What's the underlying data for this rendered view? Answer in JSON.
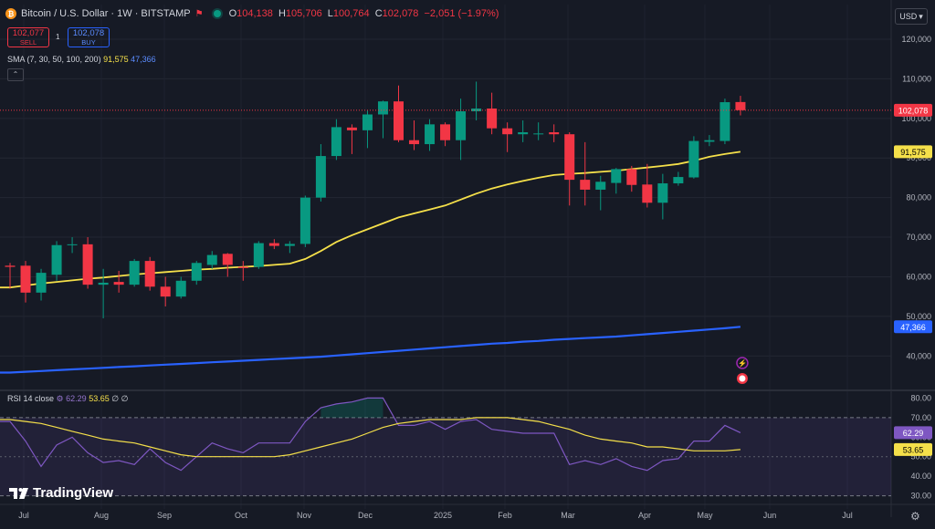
{
  "header": {
    "symbol_title": "Bitcoin / U.S. Dollar · 1W · BITSTAMP",
    "open_label": "O",
    "open": "104,138",
    "high_label": "H",
    "high": "105,706",
    "low_label": "L",
    "low": "100,764",
    "close_label": "C",
    "close": "102,078",
    "change": "−2,051 (−1.97%)"
  },
  "trade": {
    "sell_price": "102,077",
    "sell_label": "SELL",
    "buy_price": "102,078",
    "buy_label": "BUY",
    "spread": "1"
  },
  "indicators": {
    "sma_label": "SMA (7, 30, 50, 100, 200)",
    "sma_short_value": "91,575",
    "sma_long_value": "47,366",
    "rsi_label": "RSI 14 close",
    "rsi_value": "62.29",
    "rsi_ma_value": "53.65",
    "rsi_extra1": "∅",
    "rsi_extra2": "∅"
  },
  "currency": "USD",
  "branding": "TradingView",
  "colors": {
    "background": "#161a25",
    "up": "#089981",
    "down": "#f23645",
    "sma_short": "#f5e04a",
    "sma_long": "#2962ff",
    "rsi": "#7e57c2"
  },
  "chart_data": [
    {
      "type": "candlestick",
      "interval": "1W",
      "x_tick_labels": [
        "Jul",
        "Aug",
        "Sep",
        "Oct",
        "Nov",
        "Dec",
        "2025",
        "Feb",
        "Mar",
        "Apr",
        "May",
        "Jun",
        "Jul"
      ],
      "y_tick_labels": [
        "120,000",
        "110,000",
        "100,000",
        "90,000",
        "80,000",
        "70,000",
        "60,000",
        "50,000",
        "40,000"
      ],
      "ylim": [
        32000,
        123000
      ],
      "last_price_label": "102,078",
      "candles": [
        {
          "o": 62800,
          "h": 63500,
          "l": 57000,
          "c": 62500
        },
        {
          "o": 62800,
          "h": 64000,
          "l": 53500,
          "c": 56000
        },
        {
          "o": 56000,
          "h": 62000,
          "l": 54000,
          "c": 61000
        },
        {
          "o": 60500,
          "h": 69000,
          "l": 59000,
          "c": 68000
        },
        {
          "o": 68000,
          "h": 70000,
          "l": 66000,
          "c": 68200
        },
        {
          "o": 68200,
          "h": 70000,
          "l": 57000,
          "c": 58000
        },
        {
          "o": 58000,
          "h": 62000,
          "l": 49500,
          "c": 58500
        },
        {
          "o": 58700,
          "h": 61500,
          "l": 56000,
          "c": 58000
        },
        {
          "o": 58000,
          "h": 64500,
          "l": 57500,
          "c": 64000
        },
        {
          "o": 64000,
          "h": 65000,
          "l": 56500,
          "c": 57500
        },
        {
          "o": 57500,
          "h": 60000,
          "l": 52500,
          "c": 55000
        },
        {
          "o": 55000,
          "h": 60000,
          "l": 54500,
          "c": 59000
        },
        {
          "o": 59000,
          "h": 64000,
          "l": 58000,
          "c": 63500
        },
        {
          "o": 63000,
          "h": 66500,
          "l": 62000,
          "c": 65500
        },
        {
          "o": 65800,
          "h": 66000,
          "l": 60000,
          "c": 63000
        },
        {
          "o": 62500,
          "h": 64000,
          "l": 59000,
          "c": 62200
        },
        {
          "o": 62500,
          "h": 69000,
          "l": 62000,
          "c": 68500
        },
        {
          "o": 68500,
          "h": 69500,
          "l": 67000,
          "c": 67800
        },
        {
          "o": 67800,
          "h": 69000,
          "l": 66000,
          "c": 68300
        },
        {
          "o": 68300,
          "h": 80500,
          "l": 67500,
          "c": 80000
        },
        {
          "o": 80000,
          "h": 93500,
          "l": 79000,
          "c": 90500
        },
        {
          "o": 90500,
          "h": 99800,
          "l": 89500,
          "c": 97800
        },
        {
          "o": 97700,
          "h": 98500,
          "l": 91000,
          "c": 97000
        },
        {
          "o": 97000,
          "h": 102000,
          "l": 92500,
          "c": 101000
        },
        {
          "o": 101000,
          "h": 104500,
          "l": 95000,
          "c": 104300
        },
        {
          "o": 104300,
          "h": 108300,
          "l": 94000,
          "c": 94500
        },
        {
          "o": 94500,
          "h": 99500,
          "l": 92000,
          "c": 93500
        },
        {
          "o": 93500,
          "h": 99800,
          "l": 91800,
          "c": 98500
        },
        {
          "o": 98500,
          "h": 99000,
          "l": 93000,
          "c": 94500
        },
        {
          "o": 94500,
          "h": 105000,
          "l": 89500,
          "c": 101800
        },
        {
          "o": 101800,
          "h": 109300,
          "l": 99500,
          "c": 102500
        },
        {
          "o": 102500,
          "h": 106500,
          "l": 96000,
          "c": 97500
        },
        {
          "o": 97500,
          "h": 99000,
          "l": 91500,
          "c": 96000
        },
        {
          "o": 96000,
          "h": 99500,
          "l": 94000,
          "c": 96500
        },
        {
          "o": 96200,
          "h": 99000,
          "l": 94500,
          "c": 96200
        },
        {
          "o": 96500,
          "h": 98500,
          "l": 94000,
          "c": 96000
        },
        {
          "o": 96000,
          "h": 96500,
          "l": 78000,
          "c": 84500
        },
        {
          "o": 84500,
          "h": 94000,
          "l": 78000,
          "c": 82000
        },
        {
          "o": 82000,
          "h": 85500,
          "l": 76800,
          "c": 84000
        },
        {
          "o": 83700,
          "h": 87500,
          "l": 81000,
          "c": 87200
        },
        {
          "o": 87200,
          "h": 88000,
          "l": 81500,
          "c": 83200
        },
        {
          "o": 83300,
          "h": 88500,
          "l": 77500,
          "c": 78700
        },
        {
          "o": 78700,
          "h": 86000,
          "l": 74500,
          "c": 83600
        },
        {
          "o": 83600,
          "h": 86500,
          "l": 83000,
          "c": 85200
        },
        {
          "o": 85100,
          "h": 95500,
          "l": 84800,
          "c": 94300
        },
        {
          "o": 94100,
          "h": 95800,
          "l": 93000,
          "c": 94500
        },
        {
          "o": 94300,
          "h": 105000,
          "l": 93500,
          "c": 104100
        },
        {
          "o": 104138,
          "h": 105706,
          "l": 100764,
          "c": 102078
        }
      ],
      "sma_series": [
        {
          "name": "SMA (short)",
          "value_label": "91,575",
          "values": [
            57300,
            57800,
            58300,
            58700,
            59100,
            59500,
            59800,
            60200,
            60600,
            60900,
            61200,
            61500,
            61800,
            62000,
            62300,
            62500,
            62700,
            63000,
            63300,
            64500,
            66500,
            68800,
            70500,
            72000,
            73500,
            75000,
            76000,
            77000,
            78000,
            79500,
            81000,
            82300,
            83300,
            84200,
            85000,
            85700,
            86000,
            86200,
            86500,
            86800,
            87200,
            87600,
            88000,
            88500,
            89300,
            90300,
            91000,
            91575
          ]
        },
        {
          "name": "SMA (long)",
          "value_label": "47,366",
          "values": [
            35800,
            36000,
            36200,
            36400,
            36600,
            36800,
            37000,
            37200,
            37400,
            37600,
            37800,
            38000,
            38200,
            38400,
            38600,
            38800,
            39000,
            39200,
            39400,
            39600,
            39800,
            40100,
            40400,
            40700,
            41000,
            41300,
            41600,
            41900,
            42200,
            42500,
            42800,
            43100,
            43300,
            43600,
            43800,
            44100,
            44300,
            44500,
            44700,
            44900,
            45200,
            45500,
            45800,
            46100,
            46400,
            46700,
            47000,
            47366
          ]
        }
      ]
    },
    {
      "type": "line",
      "title": "RSI 14 close",
      "y_tick_labels": [
        "80.00",
        "70.00",
        "60.00",
        "50.00",
        "40.00",
        "30.00"
      ],
      "ylim": [
        27,
        83
      ],
      "bands": [
        30,
        70
      ],
      "series": [
        {
          "name": "RSI",
          "value_label": "62.29",
          "values": [
            68,
            58,
            45,
            56,
            60,
            52,
            47,
            48,
            46,
            54,
            47,
            43,
            50,
            57,
            54,
            52,
            57,
            57,
            57,
            68,
            75,
            77,
            78,
            80,
            80,
            66,
            66,
            68,
            64,
            68,
            69,
            64,
            63,
            62,
            62,
            62,
            46,
            48,
            46,
            49,
            45,
            43,
            48,
            49,
            58,
            58,
            66,
            62.29
          ]
        },
        {
          "name": "RSI-based MA",
          "value_label": "53.65",
          "values": [
            69,
            68,
            67,
            65,
            63,
            61,
            59,
            58,
            57,
            55,
            53,
            51,
            50,
            50,
            50,
            50,
            50,
            50,
            51,
            53,
            55,
            57,
            59,
            62,
            65,
            67,
            68,
            69,
            69,
            69,
            70,
            70,
            70,
            69,
            68,
            66,
            64,
            61,
            59,
            58,
            57,
            55,
            55,
            54,
            53,
            53,
            53,
            53.65
          ]
        }
      ]
    }
  ]
}
